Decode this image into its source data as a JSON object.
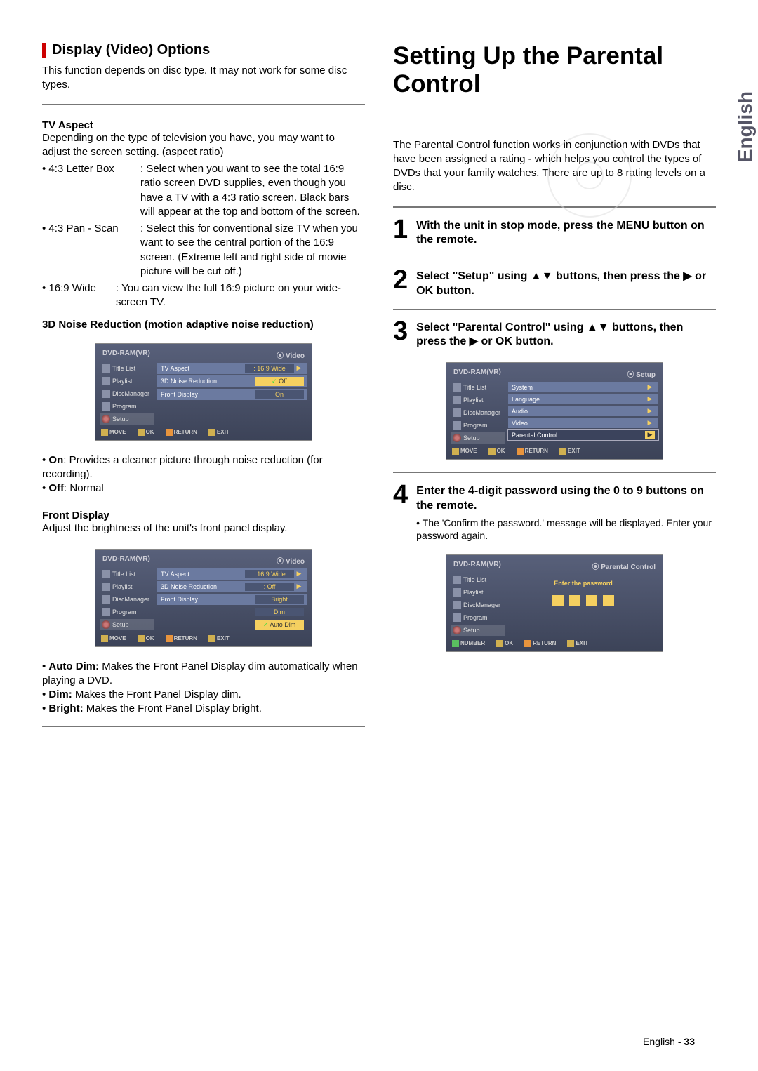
{
  "lang_tab": "English",
  "page_footer": {
    "language": "English",
    "sep": " - ",
    "page": "33"
  },
  "left": {
    "section_title": "Display (Video) Options",
    "intro": "This function depends on disc type. It may not work for some disc types.",
    "tv_aspect_heading": "TV Aspect",
    "tv_aspect_intro": "Depending on the type of television you have, you may want to adjust the screen setting. (aspect ratio)",
    "tv_aspect_items": [
      {
        "label": "• 4:3 Letter Box",
        "desc": ": Select when you want to see the total 16:9 ratio screen DVD supplies, even though you have a TV with a 4:3 ratio screen. Black bars will appear at the top and bottom of the screen."
      },
      {
        "label": "• 4:3 Pan - Scan",
        "desc": ": Select this for conventional size TV when you want to see the central portion of the 16:9 screen. (Extreme left and right side of movie picture will be cut off.)"
      },
      {
        "label": "• 16:9 Wide",
        "desc": ": You can view the full 16:9 picture on your wide-screen TV."
      }
    ],
    "nr_heading": "3D Noise Reduction (motion adaptive noise reduction)",
    "nr_on": "On",
    "nr_on_desc": ": Provides a cleaner picture through noise reduction (for recording).",
    "nr_off": "Off",
    "nr_off_desc": ": Normal",
    "fd_heading": "Front Display",
    "fd_intro": "Adjust the brightness of the unit's front panel display.",
    "fd_auto_dim": "Auto Dim:",
    "fd_auto_dim_desc": " Makes the Front Panel Display dim automatically when playing a DVD.",
    "fd_dim": "Dim:",
    "fd_dim_desc": " Makes the Front Panel Display dim.",
    "fd_bright": "Bright:",
    "fd_bright_desc": " Makes the Front Panel Display bright."
  },
  "right": {
    "main_title": "Setting Up the Parental Control",
    "intro": "The Parental Control function works in conjunction with DVDs that have been assigned a rating - which helps you control the types of DVDs that your family watches. There are up to 8 rating levels on a disc.",
    "steps": [
      {
        "num": "1",
        "text": "With the unit in stop mode, press the MENU button on the remote."
      },
      {
        "num": "2",
        "text": "Select \"Setup\" using ▲▼ buttons, then press the ▶ or OK button."
      },
      {
        "num": "3",
        "text": "Select \"Parental Control\" using ▲▼ buttons, then press the ▶ or OK button."
      },
      {
        "num": "4",
        "text": "Enter the 4-digit password using the 0 to 9 buttons on the remote.",
        "sub": "• The 'Confirm the password.' message will be displayed. Enter your password again."
      }
    ]
  },
  "osd_common": {
    "device": "DVD-RAM(VR)",
    "sidebar": [
      "Title List",
      "Playlist",
      "DiscManager",
      "Program",
      "Setup"
    ],
    "move": "MOVE",
    "ok": "OK",
    "ret": "RETURN",
    "exit": "EXIT",
    "number": "NUMBER"
  },
  "osd1": {
    "crumb": "Video",
    "rows": [
      {
        "label": "TV Aspect",
        "val": ": 16:9 Wide"
      },
      {
        "label": "3D Noise Reduction",
        "val": "Off",
        "check": true
      },
      {
        "label": "Front Display",
        "val": "On"
      }
    ]
  },
  "osd2": {
    "crumb": "Video",
    "rows": [
      {
        "label": "TV Aspect",
        "val": ": 16:9 Wide"
      },
      {
        "label": "3D Noise Reduction",
        "val": ": Off"
      },
      {
        "label": "Front Display",
        "val1": "Bright",
        "val2": "Dim",
        "val3": "Auto Dim"
      }
    ]
  },
  "osd3": {
    "crumb": "Setup",
    "rows": [
      {
        "label": "System"
      },
      {
        "label": "Language"
      },
      {
        "label": "Audio"
      },
      {
        "label": "Video"
      },
      {
        "label": "Parental Control",
        "sel": true
      }
    ]
  },
  "osd4": {
    "crumb": "Parental Control",
    "prompt": "Enter the password"
  }
}
